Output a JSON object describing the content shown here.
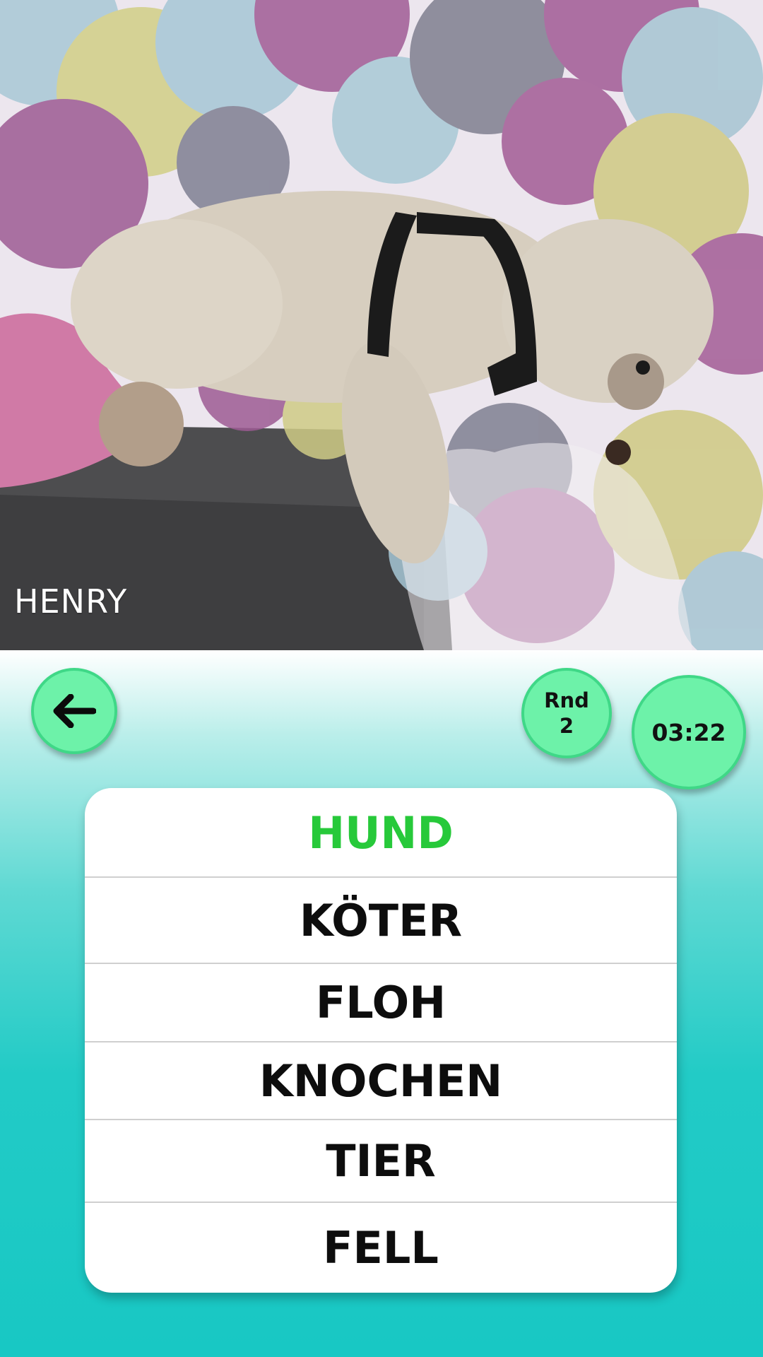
{
  "photo": {
    "caption": "HENRY",
    "image_icon": "sleeping-dog-photo"
  },
  "header": {
    "back_icon": "arrow-left-icon",
    "round_label": "Rnd",
    "round_number": "2",
    "timer": "03:22"
  },
  "card": {
    "target_word": "HUND",
    "forbidden_words": [
      "KÖTER",
      "FLOH",
      "KNOCHEN",
      "TIER",
      "FELL"
    ]
  },
  "colors": {
    "button_fill": "#6df2a9",
    "button_border": "#3fd887",
    "target_word": "#27c93a",
    "background_bottom": "#18c8c4"
  }
}
